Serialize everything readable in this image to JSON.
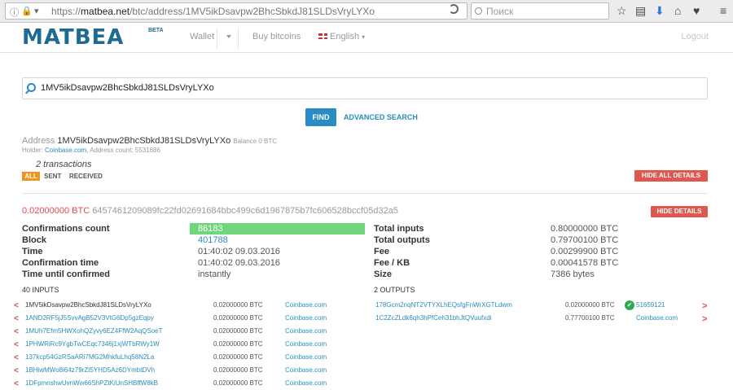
{
  "browser": {
    "url_prefix": "https://",
    "url_host": "matbea.net",
    "url_path": "/btc/address/1MV5ikDsavpw2BhcSbkdJ81SLDsVryLYXo",
    "search_placeholder": "Поиск"
  },
  "header": {
    "logo": "MATBEA",
    "logo_sup": "BETA",
    "nav_wallet": "Wallet",
    "nav_buy": "Buy bitcoins",
    "nav_language": "English",
    "nav_logout": "Logout"
  },
  "search": {
    "value": "1MV5ikDsavpw2BhcSbkdJ81SLDsVryLYXo",
    "find_label": "FIND",
    "advanced_label": "ADVANCED SEARCH"
  },
  "address": {
    "label": "Address",
    "value": "1MV5ikDsavpw2BhcSbkdJ81SLDsVryLYXo",
    "balance": "Balance 0 BTC",
    "holder_label": "Holder:",
    "holder": "Coinbase.com",
    "count_label": ", Address count:",
    "count": "5531686",
    "tx_count": "2 transactions",
    "filter_all": "ALL",
    "filter_sent": "SENT",
    "filter_received": "RECEIVED",
    "hide_all": "HIDE ALL DETAILS"
  },
  "tx": {
    "amount": "0.02000000 BTC",
    "hash": "6457461209089fc22fd02691684bbc499c6d1967875b7fc606528bccf05d32a5",
    "hide_details": "HIDE DETAILS",
    "left": [
      {
        "label": "Confirmations count",
        "value": "86183"
      },
      {
        "label": "Block",
        "value": "401788"
      },
      {
        "label": "Time",
        "value": "01:40:02 09.03.2016"
      },
      {
        "label": "Confirmation time",
        "value": "01:40:02 09.03.2016"
      },
      {
        "label": "Time until confirmed",
        "value": "instantly"
      }
    ],
    "right": [
      {
        "label": "Total inputs",
        "value": "0.80000000 BTC"
      },
      {
        "label": "Total outputs",
        "value": "0.79700100 BTC"
      },
      {
        "label": "Fee",
        "value": "0.00299900 BTC"
      },
      {
        "label": "Fee / KB",
        "value": "0.00041578 BTC"
      },
      {
        "label": "Size",
        "value": "7386 bytes"
      }
    ],
    "inputs_header": "40 INPUTS",
    "outputs_header": "2 OUTPUTS",
    "inputs": [
      {
        "address": "1MV5ikDsavpw2BhcSbkdJ81SLDsVryLYXo",
        "amount": "0.02000000 BTC",
        "owner": "Coinbase.com"
      },
      {
        "address": "1AND2RF5jJ5SvvAgB52V3VtG6Dp5gzEqpy",
        "amount": "0.02000000 BTC",
        "owner": "Coinbase.com"
      },
      {
        "address": "1MUh7Efm5HWXohQZyvy6EZ4FfW2AqQSoeT",
        "amount": "0.02000000 BTC",
        "owner": "Coinbase.com"
      },
      {
        "address": "1PHWRiRc9YgbTwCEqc7346j1xjWTbRWy1W",
        "amount": "0.02000000 BTC",
        "owner": "Coinbase.com"
      },
      {
        "address": "137kcp54GzRSaARi7MG2MhkfuLhq58N2La",
        "amount": "0.02000000 BTC",
        "owner": "Coinbase.com"
      },
      {
        "address": "1BHiwMWo8i64z79rZt5YHD5Az6DYmbtDVh",
        "amount": "0.02000000 BTC",
        "owner": "Coinbase.com"
      },
      {
        "address": "1DFpmnshwUvnWw66ShPZtKiUnSHBffW8kB",
        "amount": "0.02000000 BTC",
        "owner": "Coinbase.com"
      }
    ],
    "outputs": [
      {
        "address": "178Gcm2nqNT2VTYXLhEQsfgFnWrXGTLdwm",
        "amount": "0.02000000 BTC",
        "owner": "51659121",
        "spent": true
      },
      {
        "address": "1C2ZcZLdk6qh3hPfCeh31bhJtQVuufxdi",
        "amount": "0.77700100 BTC",
        "owner": "Coinbase.com",
        "spent": false
      }
    ],
    "arrow_left": "<",
    "arrow_right": ">"
  }
}
